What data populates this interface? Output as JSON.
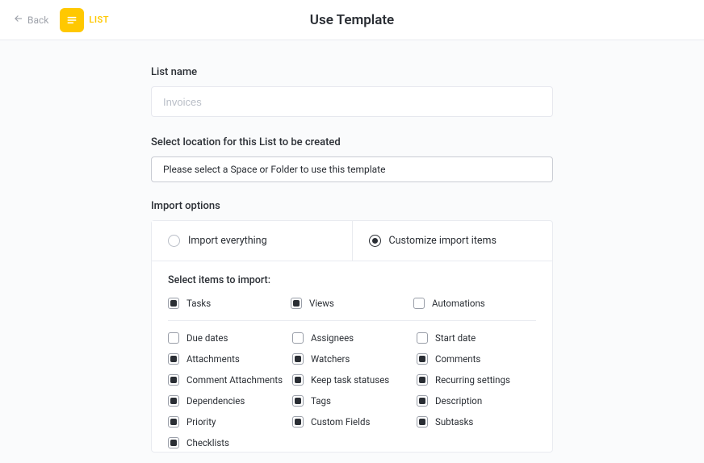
{
  "header": {
    "back_label": "Back",
    "badge_text": "LIST",
    "title": "Use Template"
  },
  "listName": {
    "label": "List name",
    "placeholder": "Invoices",
    "value": ""
  },
  "location": {
    "label": "Select location for this List to be created",
    "placeholder": "Please select a Space or Folder to use this template"
  },
  "importOptions": {
    "label": "Import options",
    "optionA": "Import everything",
    "optionB": "Customize import items",
    "selected": "optionB",
    "subheading": "Select items to import:",
    "topItems": [
      {
        "label": "Tasks",
        "checked": true
      },
      {
        "label": "Views",
        "checked": true
      },
      {
        "label": "Automations",
        "checked": false
      }
    ],
    "gridItems": [
      {
        "label": "Due dates",
        "checked": false
      },
      {
        "label": "Assignees",
        "checked": false
      },
      {
        "label": "Start date",
        "checked": false
      },
      {
        "label": "Attachments",
        "checked": true
      },
      {
        "label": "Watchers",
        "checked": true
      },
      {
        "label": "Comments",
        "checked": true
      },
      {
        "label": "Comment Attachments",
        "checked": true
      },
      {
        "label": "Keep task statuses",
        "checked": true
      },
      {
        "label": "Recurring settings",
        "checked": true
      },
      {
        "label": "Dependencies",
        "checked": true
      },
      {
        "label": "Tags",
        "checked": true
      },
      {
        "label": "Description",
        "checked": true
      },
      {
        "label": "Priority",
        "checked": true
      },
      {
        "label": "Custom Fields",
        "checked": true
      },
      {
        "label": "Subtasks",
        "checked": true
      },
      {
        "label": "Checklists",
        "checked": true
      }
    ]
  }
}
